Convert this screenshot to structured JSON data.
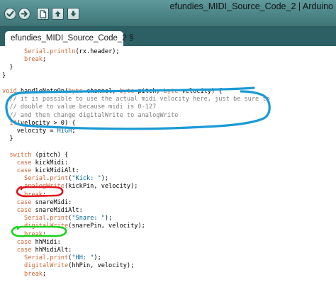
{
  "window": {
    "title": "efundies_MIDI_Source_Code_2 | Arduino"
  },
  "toolbar": {
    "verify_icon": "checkmark-icon",
    "upload_icon": "right-arrow-icon",
    "new_icon": "new-file-icon",
    "open_icon": "up-arrow-icon",
    "save_icon": "down-arrow-icon"
  },
  "tab": {
    "label": "efundies_MIDI_Source_Code_2 §"
  },
  "annotations": {
    "blue": "#1a9ad6",
    "red": "#e0141e",
    "green": "#19d21b"
  },
  "code": {
    "lines": [
      [
        {
          "t": "      "
        },
        {
          "t": "Serial",
          "c": "fn"
        },
        {
          "t": "."
        },
        {
          "t": "println",
          "c": "fn"
        },
        {
          "t": "(rx.header);"
        }
      ],
      [
        {
          "t": "      "
        },
        {
          "t": "break",
          "c": "kw"
        },
        {
          "t": ";"
        }
      ],
      [
        {
          "t": "  }"
        }
      ],
      [
        {
          "t": "}"
        }
      ],
      [
        {
          "t": ""
        }
      ],
      [
        {
          "t": "void",
          "c": "kw"
        },
        {
          "t": " handleNoteOn("
        },
        {
          "t": "byte",
          "c": "typ"
        },
        {
          "t": " channel, "
        },
        {
          "t": "byte",
          "c": "typ"
        },
        {
          "t": " pitch, "
        },
        {
          "t": "byte",
          "c": "typ"
        },
        {
          "t": " velocity) {"
        }
      ],
      [
        {
          "t": "  // it is possible to use the actual midi velocity here, just be sure to",
          "c": "cm"
        }
      ],
      [
        {
          "t": "  // double to value because midi is 0-127",
          "c": "cm"
        }
      ],
      [
        {
          "t": "  // and then change digitalWrite to analogWrite",
          "c": "cm"
        }
      ],
      [
        {
          "t": "  "
        },
        {
          "t": "if",
          "c": "kw"
        },
        {
          "t": "(velocity > 0) {"
        }
      ],
      [
        {
          "t": "    velocity = "
        },
        {
          "t": "HIGH",
          "c": "cn"
        },
        {
          "t": ";"
        }
      ],
      [
        {
          "t": "  }"
        }
      ],
      [
        {
          "t": ""
        }
      ],
      [
        {
          "t": "  "
        },
        {
          "t": "switch",
          "c": "kw"
        },
        {
          "t": " (pitch) {"
        }
      ],
      [
        {
          "t": "    "
        },
        {
          "t": "case",
          "c": "kw"
        },
        {
          "t": " kickMidi:"
        }
      ],
      [
        {
          "t": "    "
        },
        {
          "t": "case",
          "c": "kw"
        },
        {
          "t": " kickMidiAlt:"
        }
      ],
      [
        {
          "t": "      "
        },
        {
          "t": "Serial",
          "c": "fn"
        },
        {
          "t": "."
        },
        {
          "t": "print",
          "c": "fn"
        },
        {
          "t": "("
        },
        {
          "t": "\"Kick: \"",
          "c": "st"
        },
        {
          "t": ");"
        }
      ],
      [
        {
          "t": "      "
        },
        {
          "t": "analogWrite",
          "c": "fn"
        },
        {
          "t": "(kickPin, velocity);"
        }
      ],
      [
        {
          "t": "      "
        },
        {
          "t": "break",
          "c": "kw"
        },
        {
          "t": ";"
        }
      ],
      [
        {
          "t": "    "
        },
        {
          "t": "case",
          "c": "kw"
        },
        {
          "t": " snareMidi:"
        }
      ],
      [
        {
          "t": "    "
        },
        {
          "t": "case",
          "c": "kw"
        },
        {
          "t": " snareMidiAlt:"
        }
      ],
      [
        {
          "t": "      "
        },
        {
          "t": "Serial",
          "c": "fn"
        },
        {
          "t": "."
        },
        {
          "t": "print",
          "c": "fn"
        },
        {
          "t": "("
        },
        {
          "t": "\"Snare: \"",
          "c": "st"
        },
        {
          "t": ");"
        }
      ],
      [
        {
          "t": "      "
        },
        {
          "t": "digitalWrite",
          "c": "fn"
        },
        {
          "t": "(snarePin, velocity);"
        }
      ],
      [
        {
          "t": "      "
        },
        {
          "t": "break",
          "c": "kw"
        },
        {
          "t": ";"
        }
      ],
      [
        {
          "t": "    "
        },
        {
          "t": "case",
          "c": "kw"
        },
        {
          "t": " hhMidi:"
        }
      ],
      [
        {
          "t": "    "
        },
        {
          "t": "case",
          "c": "kw"
        },
        {
          "t": " hhMidiAlt:"
        }
      ],
      [
        {
          "t": "      "
        },
        {
          "t": "Serial",
          "c": "fn"
        },
        {
          "t": "."
        },
        {
          "t": "print",
          "c": "fn"
        },
        {
          "t": "("
        },
        {
          "t": "\"HH: \"",
          "c": "st"
        },
        {
          "t": ");"
        }
      ],
      [
        {
          "t": "      "
        },
        {
          "t": "digitalWrite",
          "c": "fn"
        },
        {
          "t": "(hhPin, velocity);"
        }
      ],
      [
        {
          "t": "      "
        },
        {
          "t": "break",
          "c": "kw"
        },
        {
          "t": ";"
        }
      ]
    ]
  }
}
